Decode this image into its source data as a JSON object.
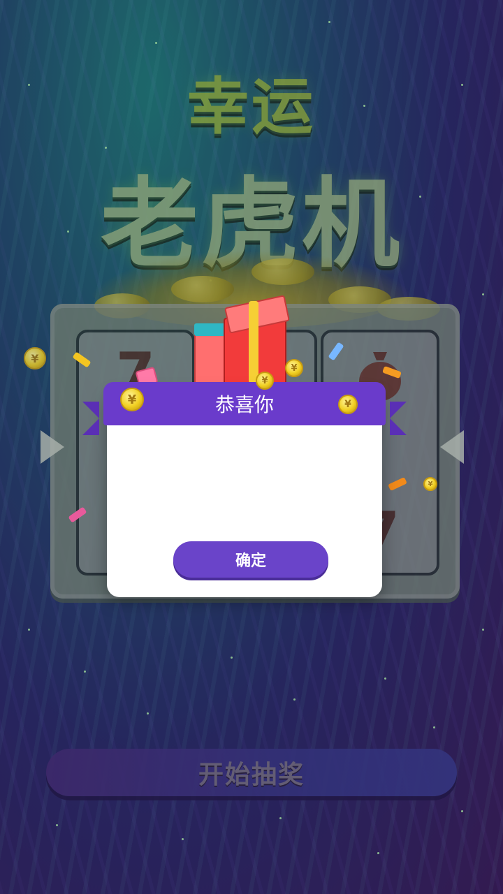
{
  "game": {
    "title_line1": "幸运",
    "title_line2": "老虎机",
    "start_label": "开始抽奖"
  },
  "reels": {
    "left_symbol": "7",
    "right_symbol_bottom": "7",
    "right_icon": "money-bag-icon"
  },
  "dialog": {
    "title": "恭喜你",
    "confirm_label": "确定",
    "coin_symbol": "¥"
  },
  "colors": {
    "accent_purple": "#6a44c9",
    "ribbon_purple": "#6a3bcb",
    "coin_gold": "#f1cf22",
    "title_green": "#a4c33c"
  }
}
